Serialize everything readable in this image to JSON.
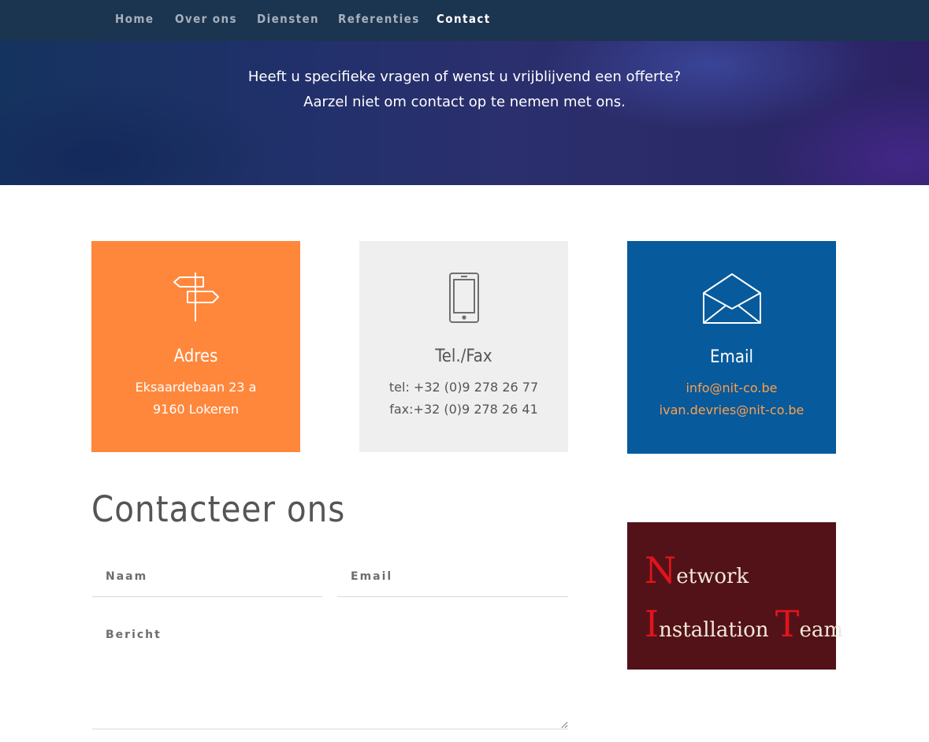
{
  "nav": {
    "items": [
      {
        "label": "Home",
        "active": false
      },
      {
        "label": "Over ons",
        "active": false
      },
      {
        "label": "Diensten",
        "active": false
      },
      {
        "label": "Referenties",
        "active": false
      },
      {
        "label": "Contact",
        "active": true
      }
    ],
    "accent_color": "#ff6a2b"
  },
  "hero": {
    "line1": "Heeft u specifieke vragen of wenst u vrijblijvend een offerte?",
    "line2": "Aarzel niet om contact op te nemen met ons."
  },
  "cards": {
    "adres": {
      "icon": "signpost-icon",
      "title": "Adres",
      "line1": "Eksaardebaan 23 a",
      "line2": "9160 Lokeren",
      "color": "#ff873c"
    },
    "tel": {
      "icon": "smartphone-icon",
      "title": "Tel./Fax",
      "line1": "tel: +32 (0)9 278 26 77",
      "line2": "fax:+32 (0)9 278 26 41",
      "color": "#efefef"
    },
    "email": {
      "icon": "envelope-icon",
      "title": "Email",
      "line1": "info@nit-co.be",
      "line2": "ivan.devries@nit-co.be",
      "color": "#075a9c"
    }
  },
  "form": {
    "title": "Contacteer ons",
    "naam_placeholder": "Naam",
    "email_placeholder": "Email",
    "bericht_placeholder": "Bericht"
  },
  "logo": {
    "line1_cap": "N",
    "line1_rest": "etwork",
    "line2_cap1": "I",
    "line2_rest1": "nstallation ",
    "line2_cap2": "T",
    "line2_rest2": "eam",
    "background": "#531218"
  }
}
